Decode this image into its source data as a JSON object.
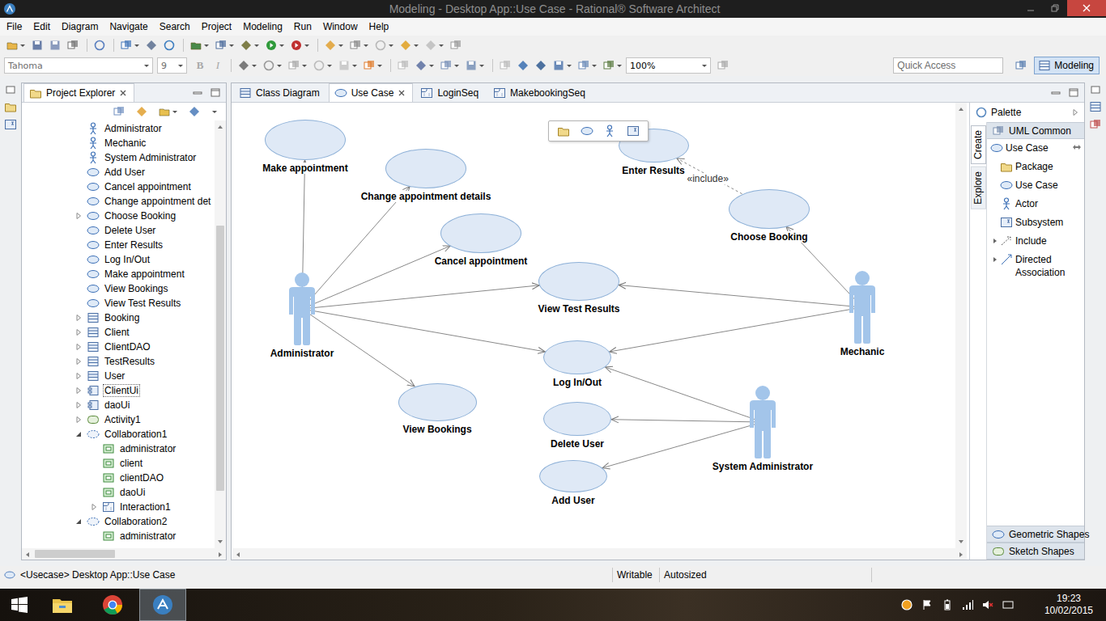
{
  "window": {
    "title": "Modeling - Desktop App::Use Case - Rational® Software Architect"
  },
  "menu": [
    "File",
    "Edit",
    "Diagram",
    "Navigate",
    "Search",
    "Project",
    "Modeling",
    "Run",
    "Window",
    "Help"
  ],
  "format_toolbar": {
    "font": "Tahoma",
    "size": "9",
    "bold": "B",
    "italic": "I",
    "disabled": true,
    "zoom": "100%"
  },
  "quick_access": {
    "placeholder": "Quick Access"
  },
  "perspective": {
    "label": "Modeling",
    "selected": true
  },
  "project_explorer": {
    "title": "Project Explorer",
    "selected": true,
    "scroll": {
      "start": 0.23,
      "size": 0.66
    },
    "hscroll": {
      "start": 0.01,
      "size": 0.44
    },
    "tree": [
      {
        "label": "Administrator",
        "kind": "actor",
        "depth": 1,
        "expandable": false,
        "expanded": false,
        "focused": false
      },
      {
        "label": "Mechanic",
        "kind": "actor",
        "depth": 1,
        "expandable": false,
        "expanded": false,
        "focused": false
      },
      {
        "label": "System Administrator",
        "kind": "actor",
        "depth": 1,
        "expandable": false,
        "expanded": false,
        "focused": false
      },
      {
        "label": "Add User",
        "kind": "usecase",
        "depth": 1,
        "expandable": false,
        "expanded": false,
        "focused": false
      },
      {
        "label": "Cancel appointment",
        "kind": "usecase",
        "depth": 1,
        "expandable": false,
        "expanded": false,
        "focused": false
      },
      {
        "label": "Change appointment det",
        "kind": "usecase",
        "depth": 1,
        "expandable": false,
        "expanded": false,
        "focused": false
      },
      {
        "label": "Choose Booking",
        "kind": "usecase",
        "depth": 1,
        "expandable": true,
        "expanded": false,
        "focused": false
      },
      {
        "label": "Delete User",
        "kind": "usecase",
        "depth": 1,
        "expandable": false,
        "expanded": false,
        "focused": false
      },
      {
        "label": "Enter Results",
        "kind": "usecase",
        "depth": 1,
        "expandable": false,
        "expanded": false,
        "focused": false
      },
      {
        "label": "Log In/Out",
        "kind": "usecase",
        "depth": 1,
        "expandable": false,
        "expanded": false,
        "focused": false
      },
      {
        "label": "Make appointment",
        "kind": "usecase",
        "depth": 1,
        "expandable": false,
        "expanded": false,
        "focused": false
      },
      {
        "label": "View Bookings",
        "kind": "usecase",
        "depth": 1,
        "expandable": false,
        "expanded": false,
        "focused": false
      },
      {
        "label": "View Test Results",
        "kind": "usecase",
        "depth": 1,
        "expandable": false,
        "expanded": false,
        "focused": false
      },
      {
        "label": "Booking",
        "kind": "class",
        "depth": 1,
        "expandable": true,
        "expanded": false,
        "focused": false
      },
      {
        "label": "Client",
        "kind": "class",
        "depth": 1,
        "expandable": true,
        "expanded": false,
        "focused": false
      },
      {
        "label": "ClientDAO",
        "kind": "class",
        "depth": 1,
        "expandable": true,
        "expanded": false,
        "focused": false
      },
      {
        "label": "TestResults",
        "kind": "class",
        "depth": 1,
        "expandable": true,
        "expanded": false,
        "focused": false
      },
      {
        "label": "User",
        "kind": "class",
        "depth": 1,
        "expandable": true,
        "expanded": false,
        "focused": false
      },
      {
        "label": "ClientUi",
        "kind": "component",
        "depth": 1,
        "expandable": true,
        "expanded": false,
        "focused": true
      },
      {
        "label": "daoUi",
        "kind": "component",
        "depth": 1,
        "expandable": true,
        "expanded": false,
        "focused": false
      },
      {
        "label": "Activity1",
        "kind": "activity",
        "depth": 1,
        "expandable": true,
        "expanded": false,
        "focused": false
      },
      {
        "label": "Collaboration1",
        "kind": "collaboration",
        "depth": 1,
        "expandable": true,
        "expanded": true,
        "focused": false
      },
      {
        "label": "administrator",
        "kind": "part",
        "depth": 2,
        "expandable": false,
        "expanded": false,
        "focused": false
      },
      {
        "label": "client",
        "kind": "part",
        "depth": 2,
        "expandable": false,
        "expanded": false,
        "focused": false
      },
      {
        "label": "clientDAO",
        "kind": "part",
        "depth": 2,
        "expandable": false,
        "expanded": false,
        "focused": false
      },
      {
        "label": "daoUi",
        "kind": "part",
        "depth": 2,
        "expandable": false,
        "expanded": false,
        "focused": false
      },
      {
        "label": "Interaction1",
        "kind": "interaction",
        "depth": 2,
        "expandable": true,
        "expanded": false,
        "focused": false
      },
      {
        "label": "Collaboration2",
        "kind": "collaboration",
        "depth": 1,
        "expandable": true,
        "expanded": true,
        "focused": false
      },
      {
        "label": "administrator",
        "kind": "part",
        "depth": 2,
        "expandable": false,
        "expanded": false,
        "focused": false
      }
    ]
  },
  "editor_tabs": [
    {
      "label": "Class Diagram",
      "kind": "class",
      "selected": false
    },
    {
      "label": "Use Case",
      "kind": "usecase",
      "selected": true
    },
    {
      "label": "LoginSeq",
      "kind": "interaction",
      "selected": false
    },
    {
      "label": "MakebookingSeq",
      "kind": "interaction",
      "selected": false
    }
  ],
  "diagram": {
    "use_cases": [
      "Make appointment",
      "Change appointment details",
      "Cancel appointment",
      "Enter Results",
      "Choose Booking",
      "View Test Results",
      "Log In/Out",
      "View Bookings",
      "Delete User",
      "Add User"
    ],
    "actors": [
      "Administrator",
      "Mechanic",
      "System Administrator"
    ],
    "relationships": [
      {
        "from": "Administrator",
        "to": "Make appointment",
        "kind": "association",
        "label": ""
      },
      {
        "from": "Administrator",
        "to": "Change appointment details",
        "kind": "association",
        "label": ""
      },
      {
        "from": "Administrator",
        "to": "Cancel appointment",
        "kind": "association",
        "label": ""
      },
      {
        "from": "Administrator",
        "to": "View Test Results",
        "kind": "association",
        "label": ""
      },
      {
        "from": "Administrator",
        "to": "Log In/Out",
        "kind": "association",
        "label": ""
      },
      {
        "from": "Administrator",
        "to": "View Bookings",
        "kind": "association",
        "label": ""
      },
      {
        "from": "Mechanic",
        "to": "Choose Booking",
        "kind": "association",
        "label": ""
      },
      {
        "from": "Mechanic",
        "to": "View Test Results",
        "kind": "association",
        "label": ""
      },
      {
        "from": "Mechanic",
        "to": "Log In/Out",
        "kind": "association",
        "label": ""
      },
      {
        "from": "System Administrator",
        "to": "Log In/Out",
        "kind": "association",
        "label": ""
      },
      {
        "from": "System Administrator",
        "to": "Delete User",
        "kind": "association",
        "label": ""
      },
      {
        "from": "System Administrator",
        "to": "Add User",
        "kind": "association",
        "label": ""
      },
      {
        "from": "Choose Booking",
        "to": "Enter Results",
        "kind": "include",
        "label": "«include»"
      }
    ]
  },
  "palette": {
    "title": "Palette",
    "tabs": [
      {
        "label": "Create",
        "selected": true
      },
      {
        "label": "Explore",
        "selected": false
      }
    ],
    "drawers": [
      {
        "label": "UML Common",
        "expanded": true,
        "items": [
          {
            "label": "Use Case",
            "kind": "usecase",
            "stack": true,
            "expandable": false
          },
          {
            "label": "Package",
            "kind": "package",
            "stack": false,
            "expandable": false
          },
          {
            "label": "Use Case",
            "kind": "usecase",
            "stack": false,
            "expandable": false
          },
          {
            "label": "Actor",
            "kind": "actor",
            "stack": false,
            "expandable": false
          },
          {
            "label": "Subsystem",
            "kind": "subsystem",
            "stack": false,
            "expandable": false
          },
          {
            "label": "Include",
            "kind": "include",
            "stack": false,
            "expandable": true
          },
          {
            "label": "Directed Association",
            "kind": "association",
            "stack": false,
            "expandable": true
          }
        ]
      },
      {
        "label": "Geometric Shapes",
        "expanded": false,
        "items": []
      },
      {
        "label": "Sketch Shapes",
        "expanded": false,
        "items": []
      }
    ]
  },
  "status_bar": {
    "path": "<Usecase> Desktop App::Use Case",
    "mode": "Writable",
    "layout": "Autosized"
  },
  "taskbar": {
    "apps": [
      {
        "kind": "file-explorer",
        "active": false
      },
      {
        "kind": "chrome",
        "active": false
      },
      {
        "kind": "rsa",
        "active": true
      }
    ],
    "tray": [
      {
        "kind": "update",
        "muted": false
      },
      {
        "kind": "flag",
        "muted": false
      },
      {
        "kind": "battery",
        "muted": false
      },
      {
        "kind": "network",
        "muted": false
      },
      {
        "kind": "volume",
        "muted": true
      },
      {
        "kind": "keyboard",
        "muted": false
      }
    ],
    "time": "19:23",
    "date": "10/02/2015"
  }
}
